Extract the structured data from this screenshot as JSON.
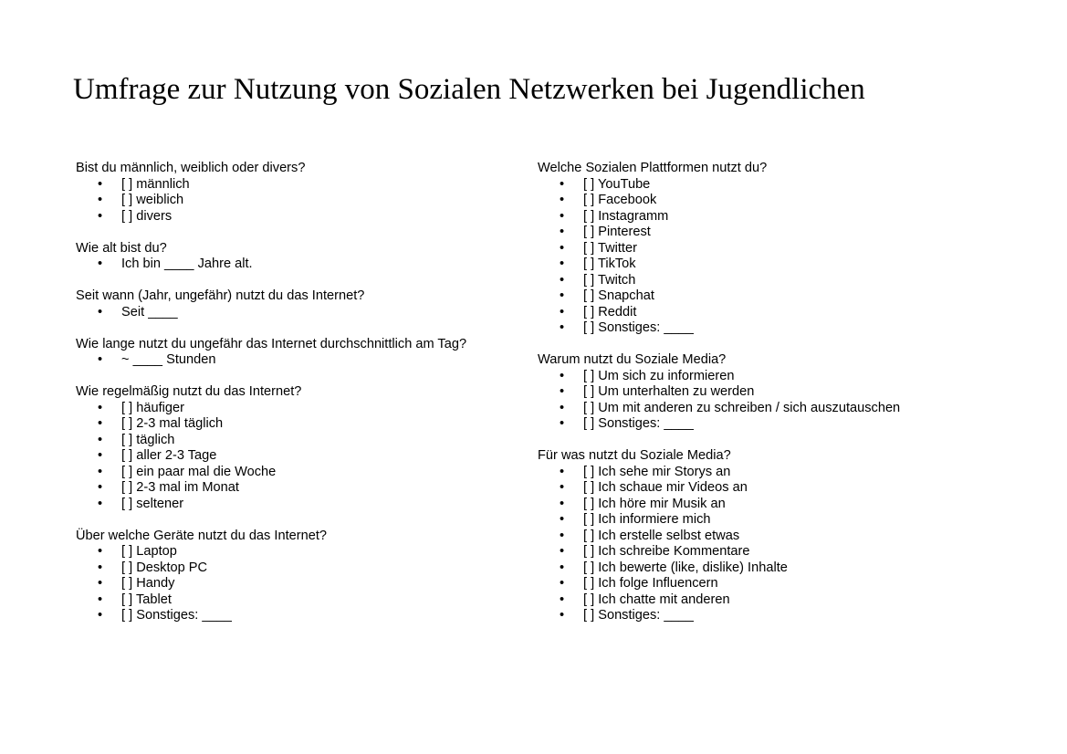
{
  "title": "Umfrage zur Nutzung von Sozialen Netzwerken bei Jugendlichen",
  "bullet_char": "•",
  "left_column": [
    {
      "question": "Bist du männlich, weiblich oder divers?",
      "options": [
        "[  ] männlich",
        "[  ] weiblich",
        "[  ] divers"
      ]
    },
    {
      "question": "Wie alt bist du?",
      "options": [
        "Ich bin ____ Jahre alt."
      ]
    },
    {
      "question": "Seit wann (Jahr, ungefähr) nutzt du das Internet?",
      "options": [
        "Seit ____"
      ]
    },
    {
      "question": "Wie lange nutzt du ungefähr das Internet durchschnittlich am Tag?",
      "options": [
        "~ ____ Stunden"
      ]
    },
    {
      "question": "Wie regelmäßig nutzt du das Internet?",
      "options": [
        "[  ] häufiger",
        "[  ] 2-3 mal täglich",
        "[  ] täglich",
        "[  ] aller 2-3 Tage",
        "[  ] ein paar mal die Woche",
        "[  ] 2-3 mal im Monat",
        "[  ] seltener"
      ]
    },
    {
      "question": "Über welche Geräte nutzt du das Internet?",
      "options": [
        "[  ] Laptop",
        "[  ] Desktop PC",
        "[  ] Handy",
        "[  ] Tablet",
        "[  ] Sonstiges: ____"
      ]
    }
  ],
  "right_column": [
    {
      "question": "Welche Sozialen Plattformen nutzt du?",
      "options": [
        "[  ] YouTube",
        "[  ] Facebook",
        "[  ] Instagramm",
        "[  ] Pinterest",
        "[  ] Twitter",
        "[  ] TikTok",
        "[  ] Twitch",
        "[  ] Snapchat",
        "[  ] Reddit",
        "[  ] Sonstiges: ____"
      ]
    },
    {
      "question": "Warum nutzt du Soziale Media?",
      "options": [
        "[  ] Um sich zu informieren",
        "[  ] Um unterhalten zu werden",
        "[  ] Um mit anderen zu schreiben / sich auszutauschen",
        "[  ] Sonstiges: ____"
      ]
    },
    {
      "question": "Für was nutzt du Soziale Media?",
      "options": [
        "[  ] Ich sehe mir Storys an",
        "[  ] Ich schaue mir Videos an",
        "[  ] Ich höre mir Musik an",
        "[  ] Ich informiere mich",
        "[  ] Ich erstelle selbst etwas",
        "[  ] Ich schreibe Kommentare",
        "[  ] Ich bewerte (like, dislike) Inhalte",
        "[  ] Ich folge Influencern",
        "[  ] Ich chatte mit anderen",
        "[  ] Sonstiges: ____"
      ]
    }
  ]
}
